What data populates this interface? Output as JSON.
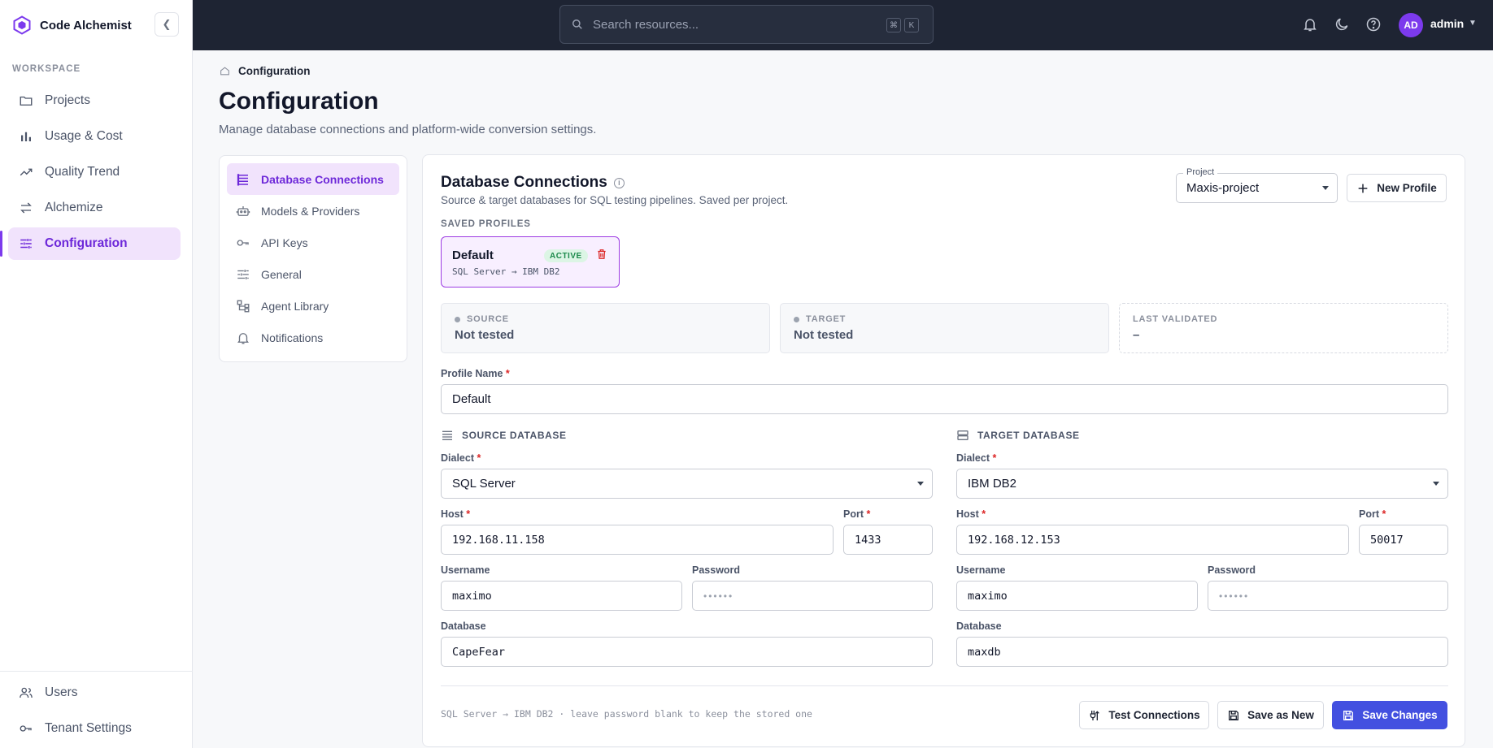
{
  "app": {
    "name": "Code Alchemist"
  },
  "sidebar": {
    "section_label": "WORKSPACE",
    "items": [
      {
        "label": "Projects",
        "icon": "folder-icon"
      },
      {
        "label": "Usage & Cost",
        "icon": "bar-chart-icon"
      },
      {
        "label": "Quality Trend",
        "icon": "trend-icon"
      },
      {
        "label": "Alchemize",
        "icon": "swap-icon"
      },
      {
        "label": "Configuration",
        "icon": "sliders-icon",
        "active": true
      }
    ],
    "bottom_items": [
      {
        "label": "Users",
        "icon": "users-icon"
      },
      {
        "label": "Tenant Settings",
        "icon": "key-icon"
      }
    ]
  },
  "topbar": {
    "search_placeholder": "Search resources...",
    "shortcut_keys": [
      "⌘",
      "K"
    ],
    "user_initials": "AD",
    "user_name": "admin"
  },
  "breadcrumb": {
    "current": "Configuration"
  },
  "page": {
    "title": "Configuration",
    "subtitle": "Manage database connections and platform-wide conversion settings."
  },
  "subnav": {
    "items": [
      {
        "label": "Database Connections",
        "icon": "database-icon",
        "active": true
      },
      {
        "label": "Models & Providers",
        "icon": "robot-icon"
      },
      {
        "label": "API Keys",
        "icon": "key-icon"
      },
      {
        "label": "General",
        "icon": "sliders-icon"
      },
      {
        "label": "Agent Library",
        "icon": "tree-icon"
      },
      {
        "label": "Notifications",
        "icon": "bell-icon"
      }
    ]
  },
  "panel": {
    "title": "Database Connections",
    "subtitle": "Source & target databases for SQL testing pipelines. Saved per project.",
    "project_label": "Project",
    "project_value": "Maxis-project",
    "new_profile_label": "New Profile",
    "saved_profiles_label": "SAVED PROFILES",
    "profile": {
      "name": "Default",
      "badge": "ACTIVE",
      "desc": "SQL Server → IBM DB2"
    },
    "status": {
      "source_label": "SOURCE",
      "source_value": "Not tested",
      "target_label": "TARGET",
      "target_value": "Not tested",
      "last_label": "LAST VALIDATED",
      "last_value": "–"
    },
    "profile_name_label": "Profile Name",
    "profile_name_value": "Default",
    "source": {
      "heading": "SOURCE DATABASE",
      "dialect_label": "Dialect",
      "dialect": "SQL Server",
      "host_label": "Host",
      "host": "192.168.11.158",
      "port_label": "Port",
      "port": "1433",
      "username_label": "Username",
      "username": "maximo",
      "password_label": "Password",
      "password": "••••••",
      "database_label": "Database",
      "database": "CapeFear"
    },
    "target": {
      "heading": "TARGET DATABASE",
      "dialect_label": "Dialect",
      "dialect": "IBM DB2",
      "host_label": "Host",
      "host": "192.168.12.153",
      "port_label": "Port",
      "port": "50017",
      "username_label": "Username",
      "username": "maximo",
      "password_label": "Password",
      "password": "••••••",
      "database_label": "Database",
      "database": "maxdb"
    },
    "footer_note": "SQL Server → IBM DB2 · leave password blank to keep the stored one",
    "buttons": {
      "test": "Test Connections",
      "save_new": "Save as New",
      "save": "Save Changes"
    }
  },
  "colors": {
    "accent": "#7c3aed",
    "primary_button": "#4350e0",
    "topbar": "#1e2433",
    "active_badge": "#1d8a4c",
    "danger": "#dc2626"
  }
}
